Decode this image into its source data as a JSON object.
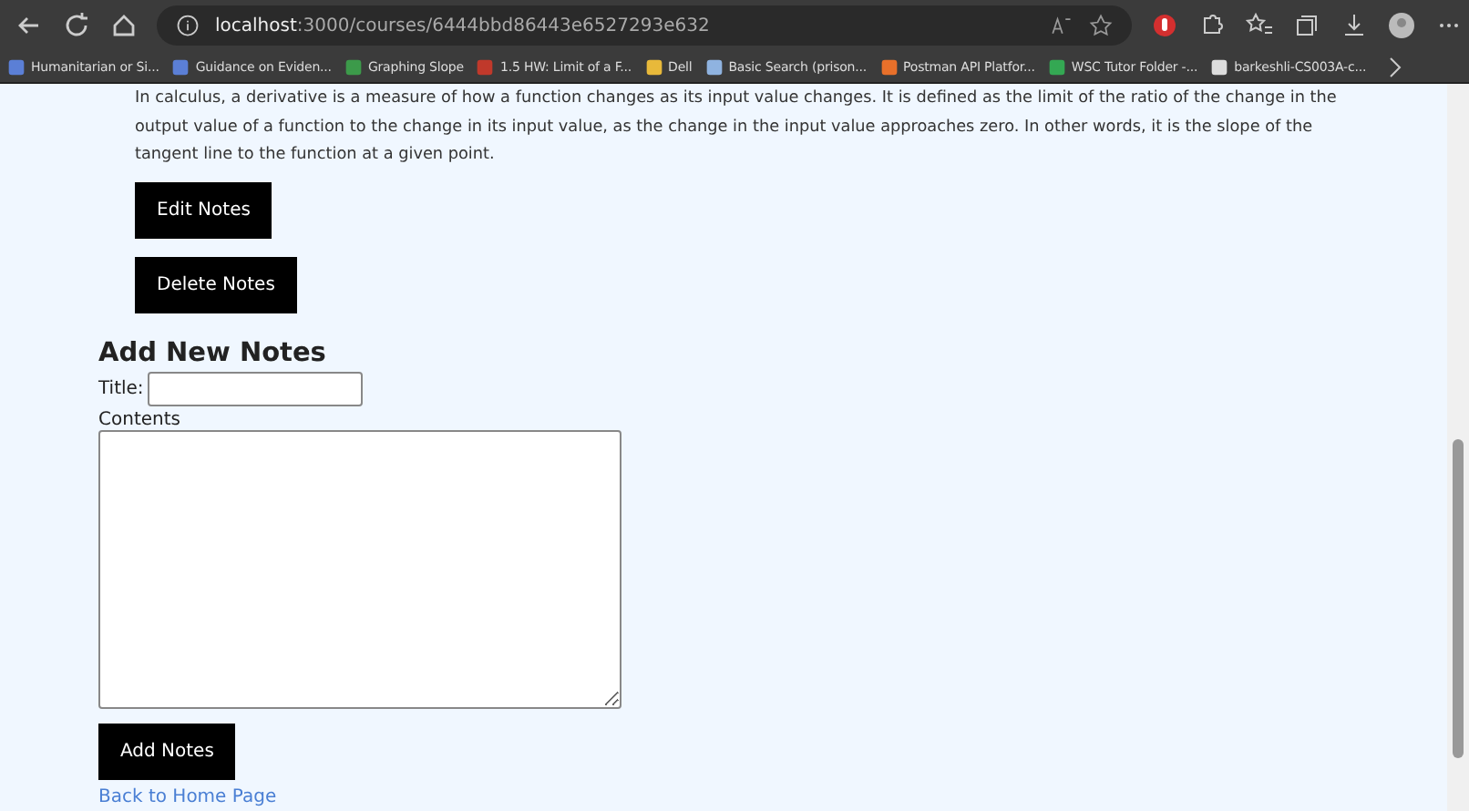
{
  "browser": {
    "url_host": "localhost",
    "url_path": ":3000/courses/6444bbd86443e6527293e632",
    "bookmarks": [
      "Humanitarian or Si...",
      "Guidance on Eviden...",
      "Graphing Slope",
      "1.5 HW: Limit of a F...",
      "Dell",
      "Basic Search (prison...",
      "Postman API Platfor...",
      "WSC Tutor Folder -...",
      "barkeshli-CS003A-c..."
    ]
  },
  "note": {
    "text": "In calculus, a derivative is a measure of how a function changes as its input value changes. It is defined as the limit of the ratio of the change in the output value of a function to the change in its input value, as the change in the input value approaches zero. In other words, it is the slope of the tangent line to the function at a given point.",
    "buttons": [
      "Edit Notes",
      "Delete Notes"
    ]
  },
  "add_form": {
    "heading": "Add New Notes",
    "title_label": "Title:",
    "contents_label": "Contents",
    "submit": "Add Notes"
  },
  "back_link": "Back to Home Page"
}
